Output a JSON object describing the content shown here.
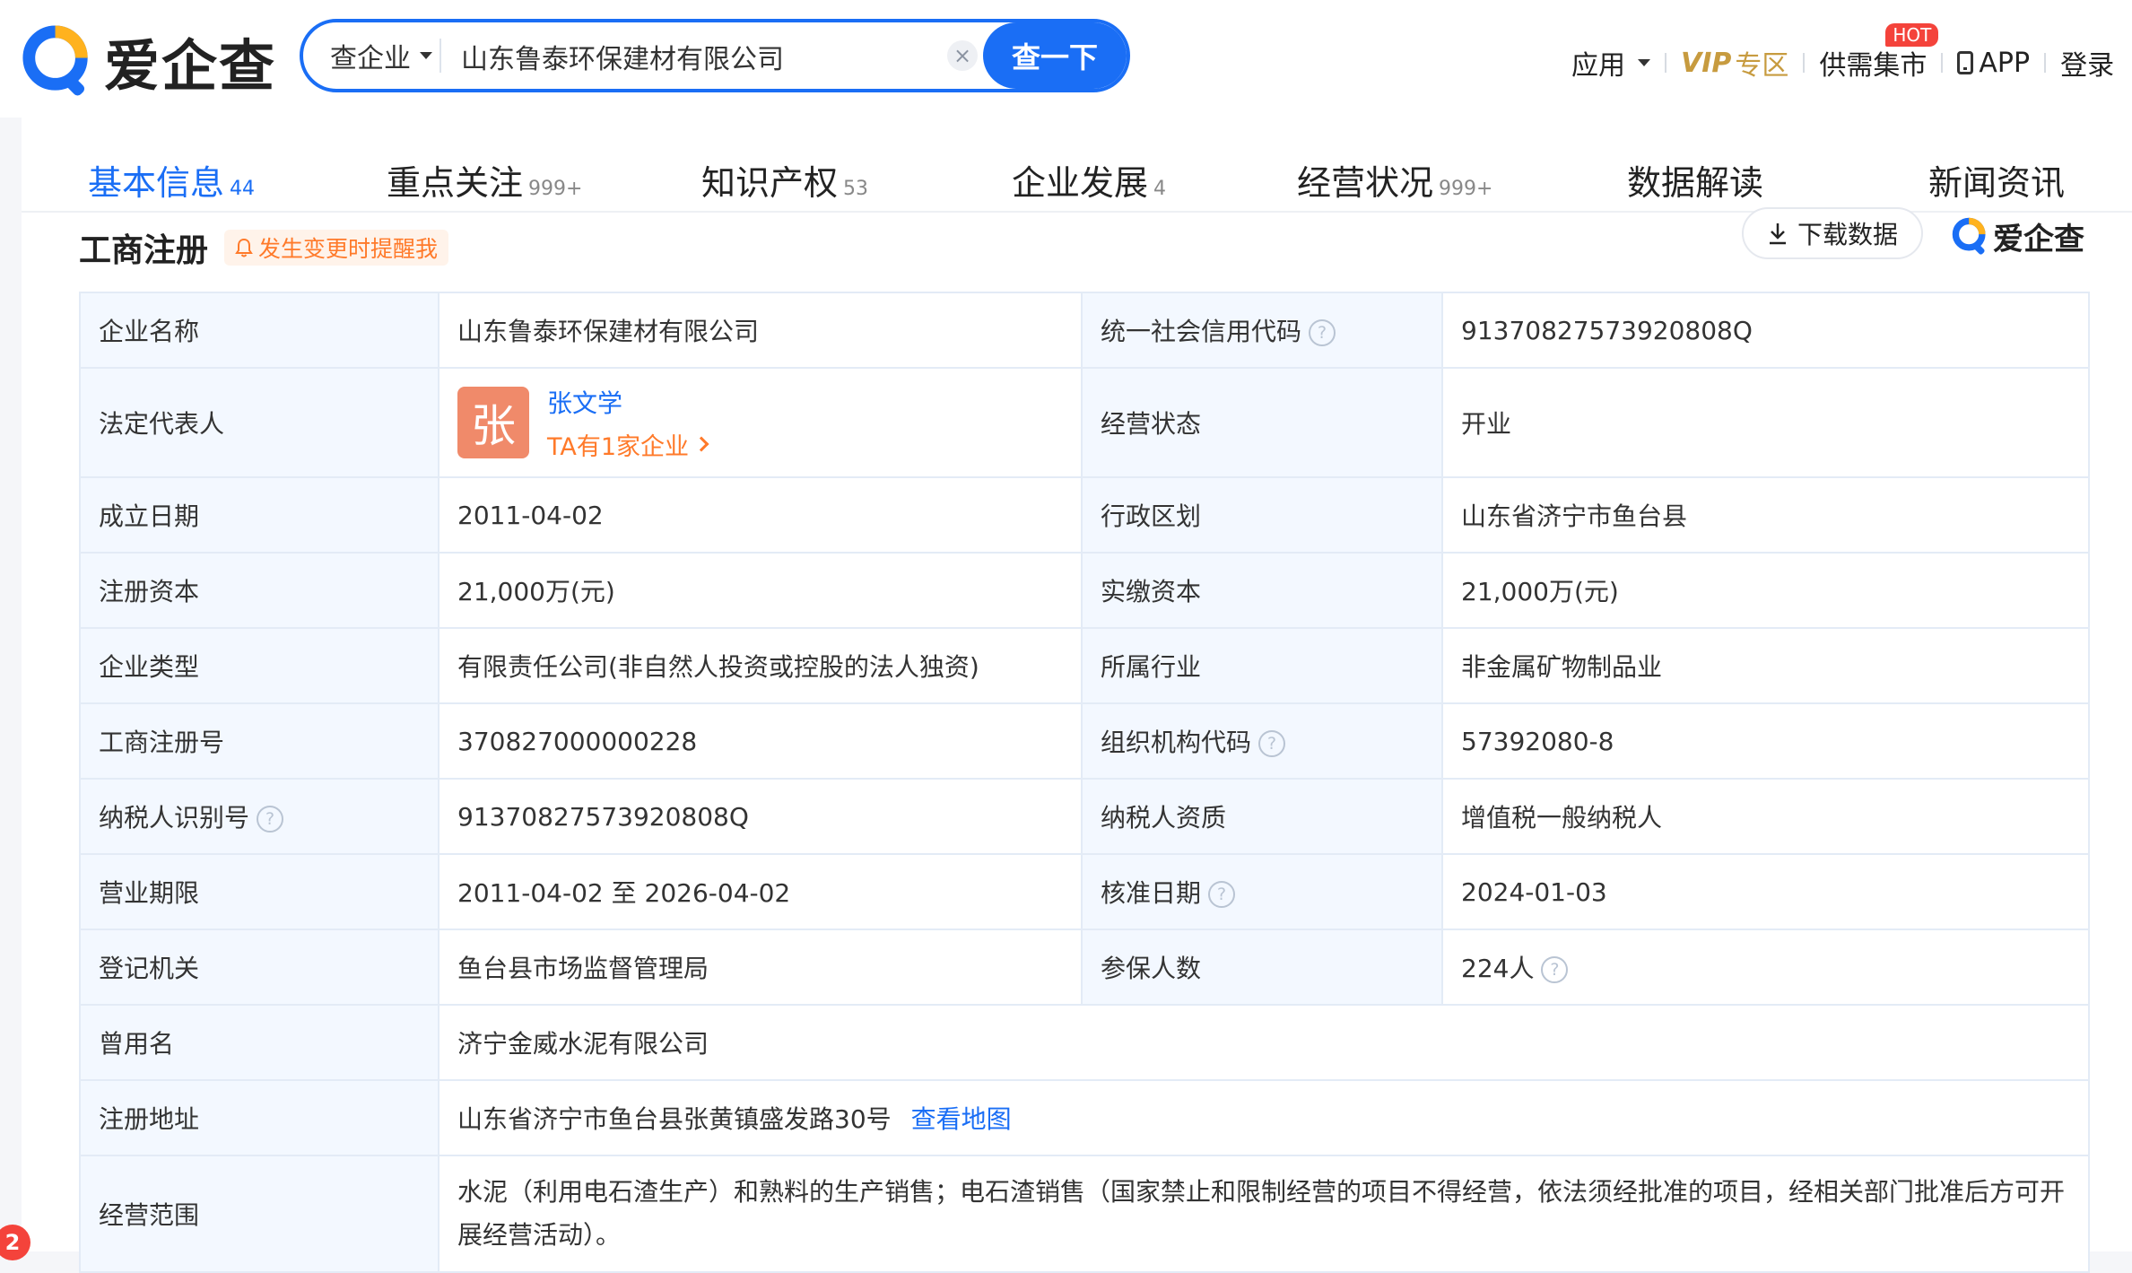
{
  "header": {
    "logo_text": "爱企查",
    "search": {
      "type_label": "查企业",
      "value": "山东鲁泰环保建材有限公司",
      "clear_symbol": "×",
      "button_label": "查一下"
    },
    "nav": {
      "apps_label": "应用",
      "vip_label": "VIP",
      "vip_sub_label": "专区",
      "market_label": "供需集市",
      "hot_badge": "HOT",
      "app_label": "APP",
      "login_label": "登录"
    }
  },
  "tabs": [
    {
      "label": "基本信息",
      "count": "44"
    },
    {
      "label": "重点关注",
      "count": "999+"
    },
    {
      "label": "知识产权",
      "count": "53"
    },
    {
      "label": "企业发展",
      "count": "4"
    },
    {
      "label": "经营状况",
      "count": "999+"
    },
    {
      "label": "数据解读",
      "count": ""
    },
    {
      "label": "新闻资讯",
      "count": ""
    }
  ],
  "section": {
    "title": "工商注册",
    "remind_label": "发生变更时提醒我",
    "download_label": "下载数据",
    "brand_label": "爱企查"
  },
  "info": {
    "company_name_label": "企业名称",
    "company_name": "山东鲁泰环保建材有限公司",
    "credit_code_label": "统一社会信用代码",
    "credit_code": "91370827573920808Q",
    "legal_rep_label": "法定代表人",
    "legal_rep_avatar": "张",
    "legal_rep_name": "张文学",
    "legal_rep_more": "TA有1家企业",
    "status_label": "经营状态",
    "status": "开业",
    "founded_label": "成立日期",
    "founded": "2011-04-02",
    "region_label": "行政区划",
    "region": "山东省济宁市鱼台县",
    "reg_capital_label": "注册资本",
    "reg_capital": "21,000万(元)",
    "paid_capital_label": "实缴资本",
    "paid_capital": "21,000万(元)",
    "type_label": "企业类型",
    "type": "有限责任公司(非自然人投资或控股的法人独资)",
    "industry_label": "所属行业",
    "industry": "非金属矿物制品业",
    "reg_no_label": "工商注册号",
    "reg_no": "370827000000228",
    "org_code_label": "组织机构代码",
    "org_code": "57392080-8",
    "tax_id_label": "纳税人识别号",
    "tax_id": "91370827573920808Q",
    "taxpayer_label": "纳税人资质",
    "taxpayer": "增值税一般纳税人",
    "term_label": "营业期限",
    "term": "2011-04-02 至 2026-04-02",
    "approval_date_label": "核准日期",
    "approval_date": "2024-01-03",
    "authority_label": "登记机关",
    "authority": "鱼台县市场监督管理局",
    "insured_label": "参保人数",
    "insured": "224人",
    "former_name_label": "曾用名",
    "former_name": "济宁金威水泥有限公司",
    "address_label": "注册地址",
    "address": "山东省济宁市鱼台县张黄镇盛发路30号",
    "map_link": "查看地图",
    "scope_label": "经营范围",
    "scope": "水泥（利用电石渣生产）和熟料的生产销售；电石渣销售（国家禁止和限制经营的项目不得经营，依法须经批准的项目，经相关部门批准后方可开展经营活动）。",
    "help_symbol": "?"
  },
  "notification_count": "2",
  "colors": {
    "accent": "#1a6ef5",
    "warning": "#ff7a2a",
    "vip": "#c79b3f",
    "hot": "#f4433b",
    "label_bg": "#f3f8ff"
  }
}
